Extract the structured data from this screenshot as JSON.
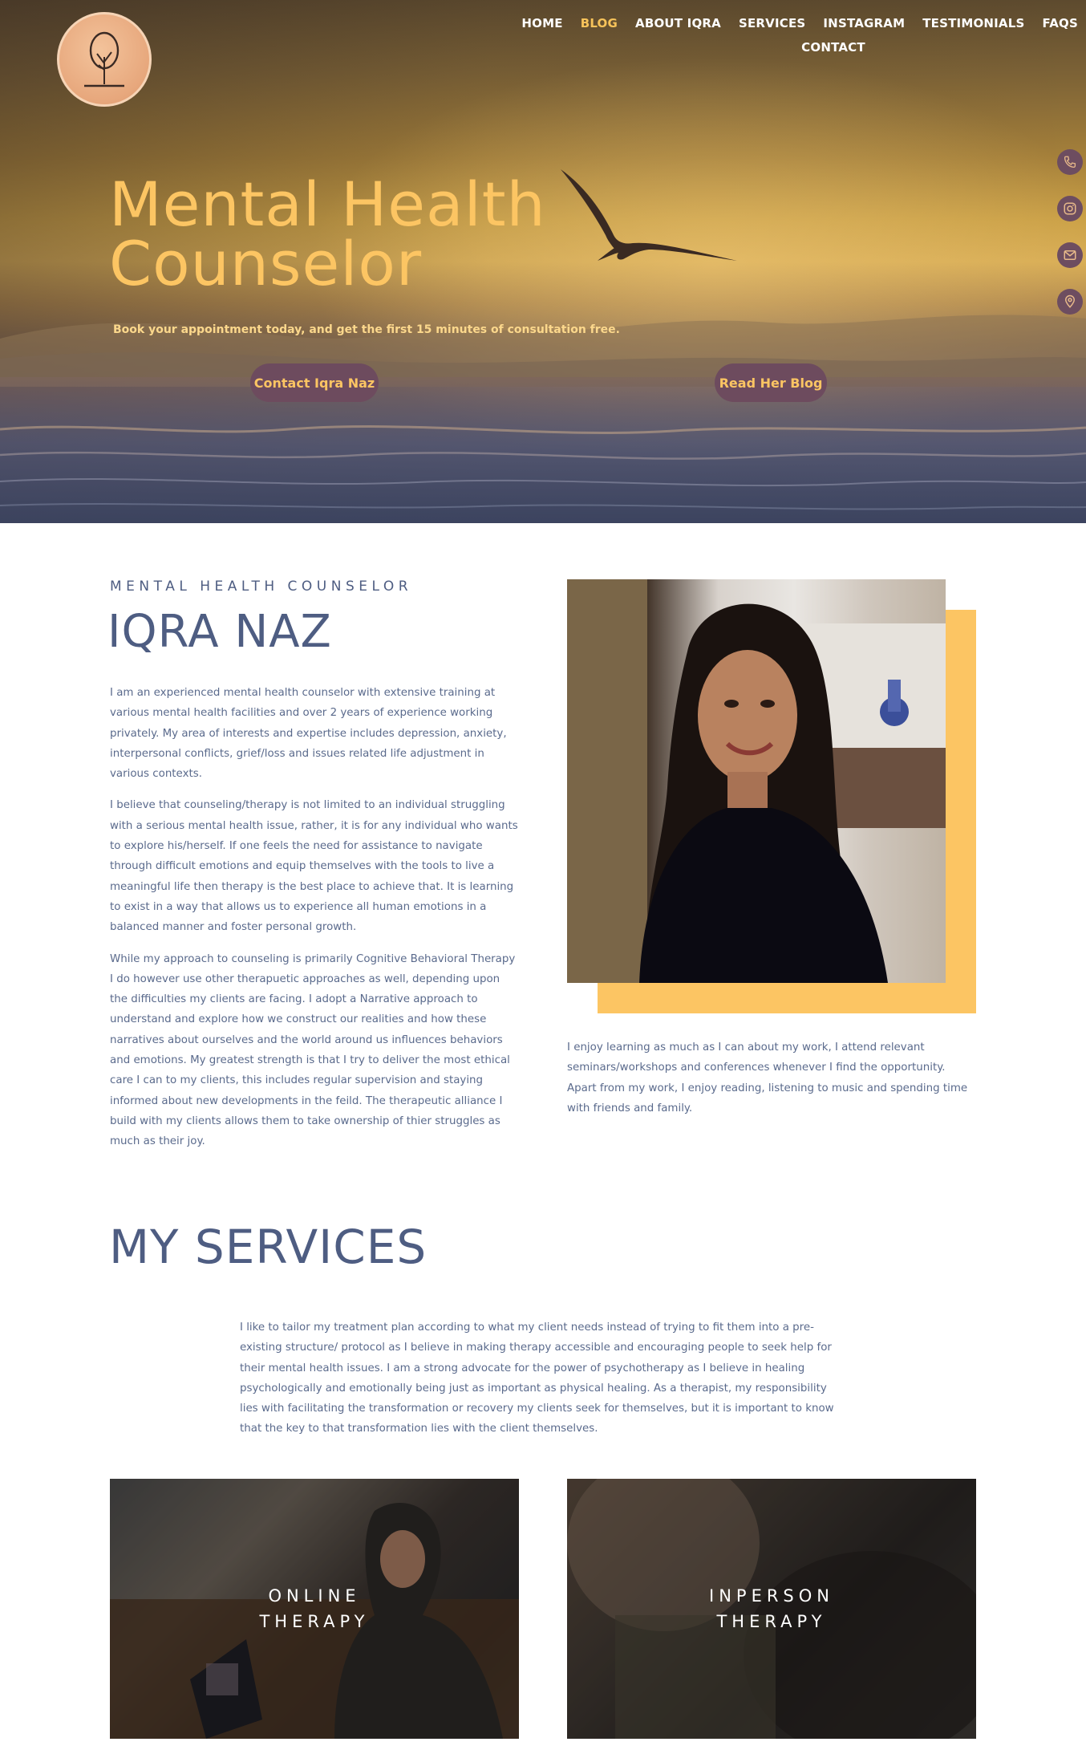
{
  "nav": {
    "items": [
      {
        "label": "HOME"
      },
      {
        "label": "BLOG"
      },
      {
        "label": "ABOUT IQRA"
      },
      {
        "label": "SERVICES"
      },
      {
        "label": "INSTAGRAM"
      },
      {
        "label": "TESTIMONIALS"
      },
      {
        "label": "FAQS"
      }
    ],
    "contact": "CONTACT",
    "active": "BLOG"
  },
  "hero": {
    "title_line1": "Mental Health",
    "title_line2": "Counselor",
    "subtitle": "Book your appointment today, and get the first 15 minutes of consultation free.",
    "btn_contact": "Contact Iqra Naz",
    "btn_blog": "Read Her Blog"
  },
  "social": [
    "phone-icon",
    "instagram-icon",
    "mail-icon",
    "location-icon"
  ],
  "about": {
    "eyebrow": "MENTAL HEALTH COUNSELOR",
    "name": "IQRA NAZ",
    "paragraphs": [
      "I am an experienced mental health counselor with extensive training at various mental health facilities and over 2 years of experience working privately. My area of interests and expertise includes depression, anxiety, interpersonal conflicts, grief/loss and issues related life adjustment in various contexts.",
      "I believe that counseling/therapy is not limited to an individual struggling with a serious mental health issue, rather, it is for any individual who wants to explore his/herself. If one feels the need for assistance to navigate through difficult emotions and equip themselves with the tools to live a meaningful life then therapy is the best place to achieve that. It is learning to exist in a way that allows us to experience all human emotions in a balanced manner and foster personal growth.",
      "While my approach to counseling is primarily Cognitive Behavioral Therapy I do however use other therapuetic approaches as well, depending upon the difficulties my clients are facing. I adopt a Narrative approach to understand and explore how we construct our realities and how these narratives about ourselves and the world around us influences behaviors and emotions. My greatest strength is that I try to deliver the most ethical care I can to my clients, this includes regular supervision and staying informed about new developments in the feild. The therapeutic alliance I build with my clients allows them to take ownership of thier struggles as much as their joy."
    ],
    "side": "I enjoy learning as much as I can about my work, I attend relevant seminars/workshops and conferences whenever I find the opportunity. Apart from my work, I enjoy reading, listening to music and spending time with friends and family."
  },
  "services": {
    "title": "MY SERVICES",
    "intro": "I like to tailor my treatment plan according to what my client needs instead of trying to fit them into a pre-existing structure/ protocol as I believe in making therapy accessible and encouraging people to seek help for their mental health issues. I am a strong advocate for the power of psychotherapy as I believe in healing psychologically and emotionally being just as important as physical healing. As a therapist, my responsibility lies with facilitating the transformation or recovery my clients seek for themselves, but it is important to know that the key to that transformation lies with the client themselves.",
    "cards": [
      {
        "line1": "ONLINE",
        "line2": "THERAPY"
      },
      {
        "line1": "INPERSON",
        "line2": "THERAPY"
      }
    ]
  },
  "colors": {
    "accent": "#fcc563",
    "heading": "#4e5d82",
    "body_text": "#5a6a8c",
    "button_bg": "#6d4b5e"
  }
}
